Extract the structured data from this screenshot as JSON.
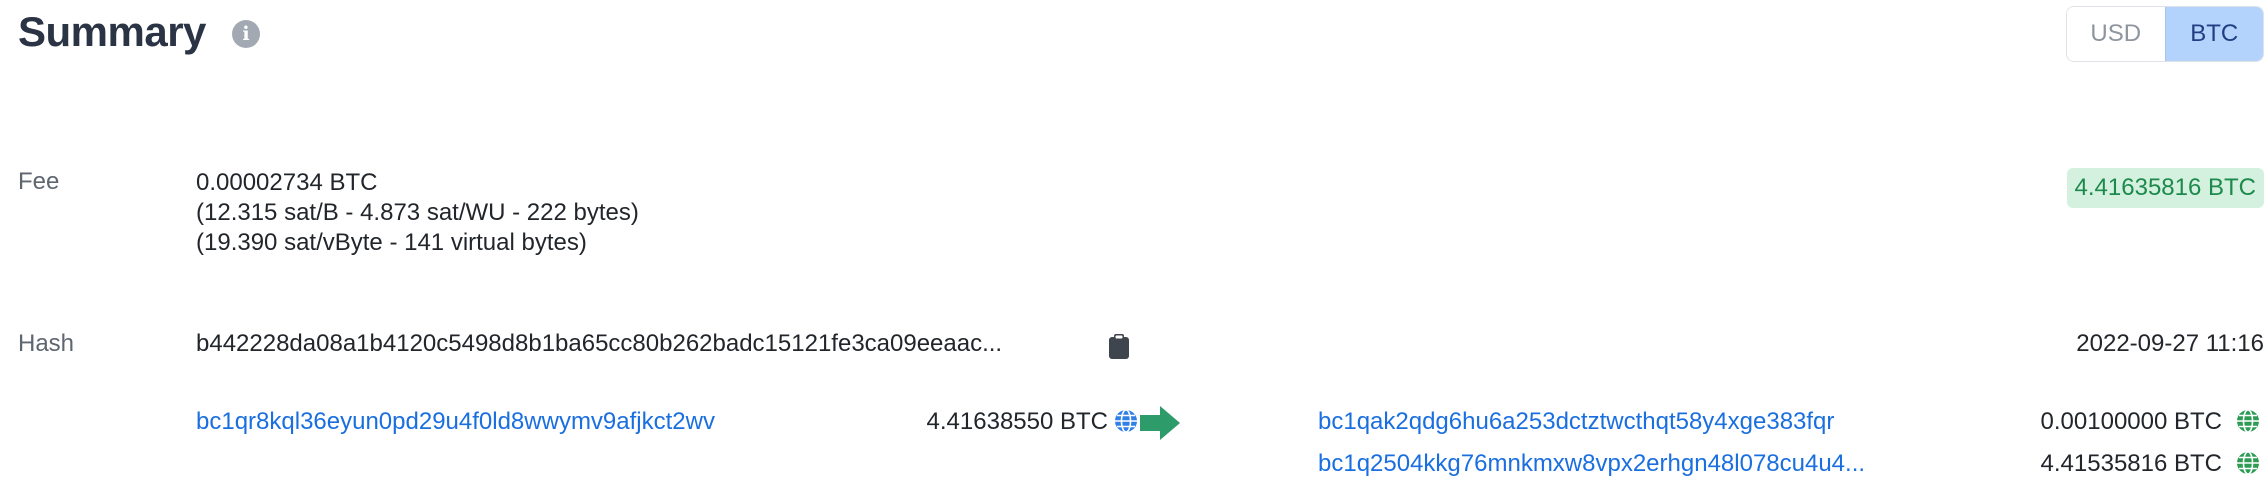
{
  "header": {
    "title": "Summary",
    "currency_toggle": {
      "usd_label": "USD",
      "btc_label": "BTC",
      "selected": "BTC"
    }
  },
  "fee": {
    "label": "Fee",
    "lines": [
      "0.00002734 BTC",
      "(12.315 sat/B - 4.873 sat/WU - 222 bytes)",
      "(19.390 sat/vByte - 141 virtual bytes)"
    ],
    "total_amount": "4.41635816 BTC"
  },
  "hash": {
    "label": "Hash",
    "value": "b442228da08a1b4120c5498d8b1ba65cc80b262badc15121fe3ca09eeaac...",
    "timestamp": "2022-09-27 11:16"
  },
  "inputs": [
    {
      "address": "bc1qr8kql36eyun0pd29u4f0ld8wwymv9afjkct2wv",
      "amount": "4.41638550 BTC"
    }
  ],
  "outputs": [
    {
      "address": "bc1qak2qdg6hu6a253dctztwcthqt58y4xge383fqr",
      "amount": "0.00100000 BTC"
    },
    {
      "address": "bc1q2504kkg76mnkmxw8vpx2erhgn48l078cu4u4...",
      "amount": "4.41535816 BTC"
    }
  ],
  "colors": {
    "link": "#1a6fe0",
    "badge_bg": "#d4f1df",
    "badge_text": "#1d8a4c",
    "arrow": "#2e9b6a",
    "input_globe": "#2f7fe6",
    "output_globe": "#2e9b55"
  },
  "icons": {
    "title_info": "info-icon",
    "hash_copy": "clipboard-icon",
    "input_globe": "globe-icon",
    "transfer": "arrow-right-icon",
    "output_globe": "globe-icon"
  }
}
